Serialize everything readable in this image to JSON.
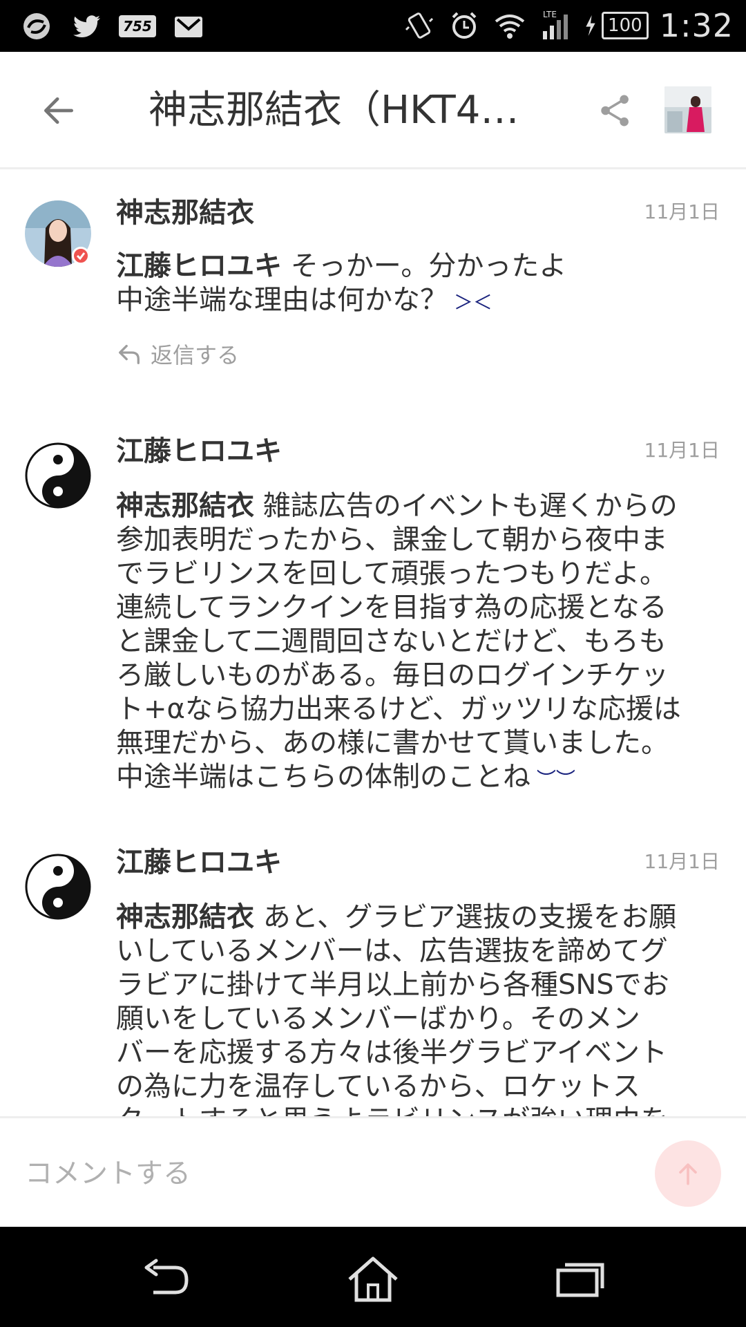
{
  "status_bar": {
    "time": "1:32",
    "battery": "100",
    "network": "LTE",
    "badge_755": "755",
    "icons": [
      "sync-icon",
      "twitter-icon",
      "755-app-icon",
      "gmail-icon",
      "vibrate-icon",
      "alarm-icon",
      "wifi-icon",
      "signal-icon",
      "charging-icon"
    ]
  },
  "header": {
    "title": "神志那結衣（HKT4…",
    "back_icon": "back-arrow-icon",
    "share_icon": "share-icon"
  },
  "comments": [
    {
      "name": "神志那結衣",
      "date": "11月1日",
      "mention": "江藤ヒロユキ",
      "text": " そっかー。分かったよ\n中途半端な理由は何かな？",
      "emoji": "frown-emoji",
      "reply_label": "返信する",
      "verified": true
    },
    {
      "name": "江藤ヒロユキ",
      "date": "11月1日",
      "mention": "神志那結衣",
      "text": " 雑誌広告のイベントも遅くからの\n参加表明だったから、課金して朝から夜中ま\nでラビリンスを回して頑張ったつもりだよ。\n連続してランクインを目指す為の応援となる\nと課金して二週間回さないとだけど、もろも\nろ厳しいものがある。毎日のログインチケッ\nト+αなら協力出来るけど、ガッツリな応援は\n無理だから、あの様に書かせて貰いました。\n中途半端はこちらの体制のことね",
      "emoji": "sweat-emoji"
    },
    {
      "name": "江藤ヒロユキ",
      "date": "11月1日",
      "mention": "神志那結衣",
      "text": " あと、グラビア選抜の支援をお願\nいしているメンバーは、広告選抜を諦めてグ\nラビアに掛けて半月以上前から各種SNSでお\n願いをしているメンバーばかり。そのメン\nバーを応援する方々は後半グラビアイベント\nの為に力を温存しているから、ロケットス\nタートすると思うよラビリンスが強い理由を"
    }
  ],
  "input": {
    "placeholder": "コメントする"
  },
  "nav": {
    "icons": [
      "back-nav-icon",
      "home-nav-icon",
      "recents-nav-icon"
    ]
  },
  "colors": {
    "accent": "#ef5350",
    "send_button_bg": "#fde3e3",
    "text": "#333333",
    "muted": "#9e9e9e"
  }
}
